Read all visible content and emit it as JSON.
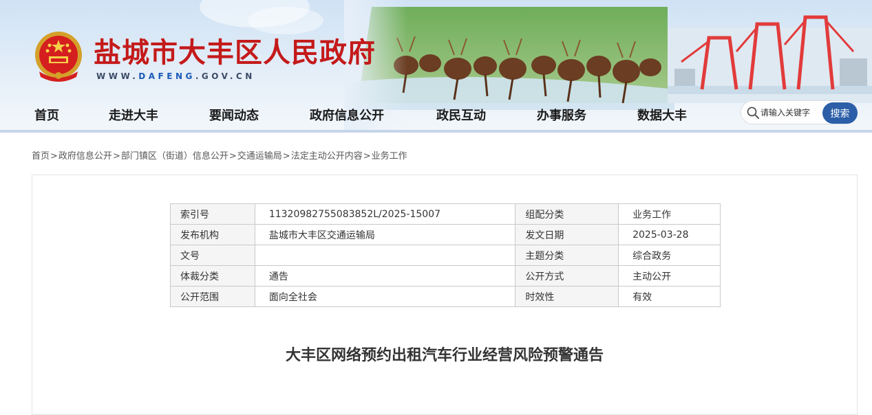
{
  "header": {
    "site_title": "盐城市大丰区人民政府",
    "site_url_prefix": "WWW.",
    "site_url_highlight": "DAFENG",
    "site_url_suffix": ".GOV.CN"
  },
  "nav": {
    "items": [
      "首页",
      "走进大丰",
      "要闻动态",
      "政府信息公开",
      "政民互动",
      "办事服务",
      "数据大丰"
    ]
  },
  "search": {
    "placeholder": "请输入关键字",
    "button_label": "搜索"
  },
  "breadcrumb": [
    "首页",
    "政府信息公开",
    "部门镇区（街道）信息公开",
    "交通运输局",
    "法定主动公开内容",
    "业务工作"
  ],
  "breadcrumb_separator": ">",
  "meta": {
    "rows": [
      {
        "k1": "索引号",
        "v1": "11320982755083852L/2025-15007",
        "k2": "组配分类",
        "v2": "业务工作"
      },
      {
        "k1": "发布机构",
        "v1": "盐城市大丰区交通运输局",
        "k2": "发文日期",
        "v2": "2025-03-28"
      },
      {
        "k1": "文号",
        "v1": "",
        "k2": "主题分类",
        "v2": "综合政务"
      },
      {
        "k1": "体裁分类",
        "v1": "通告",
        "k2": "公开方式",
        "v2": "主动公开"
      },
      {
        "k1": "公开范围",
        "v1": "面向全社会",
        "k2": "时效性",
        "v2": "有效"
      }
    ]
  },
  "article": {
    "title": "大丰区网络预约出租汽车行业经营风险预警通告"
  },
  "colors": {
    "title_red": "#c41a1a",
    "search_button": "#2c5fa8",
    "nav_underline": "#c6d5e8"
  }
}
